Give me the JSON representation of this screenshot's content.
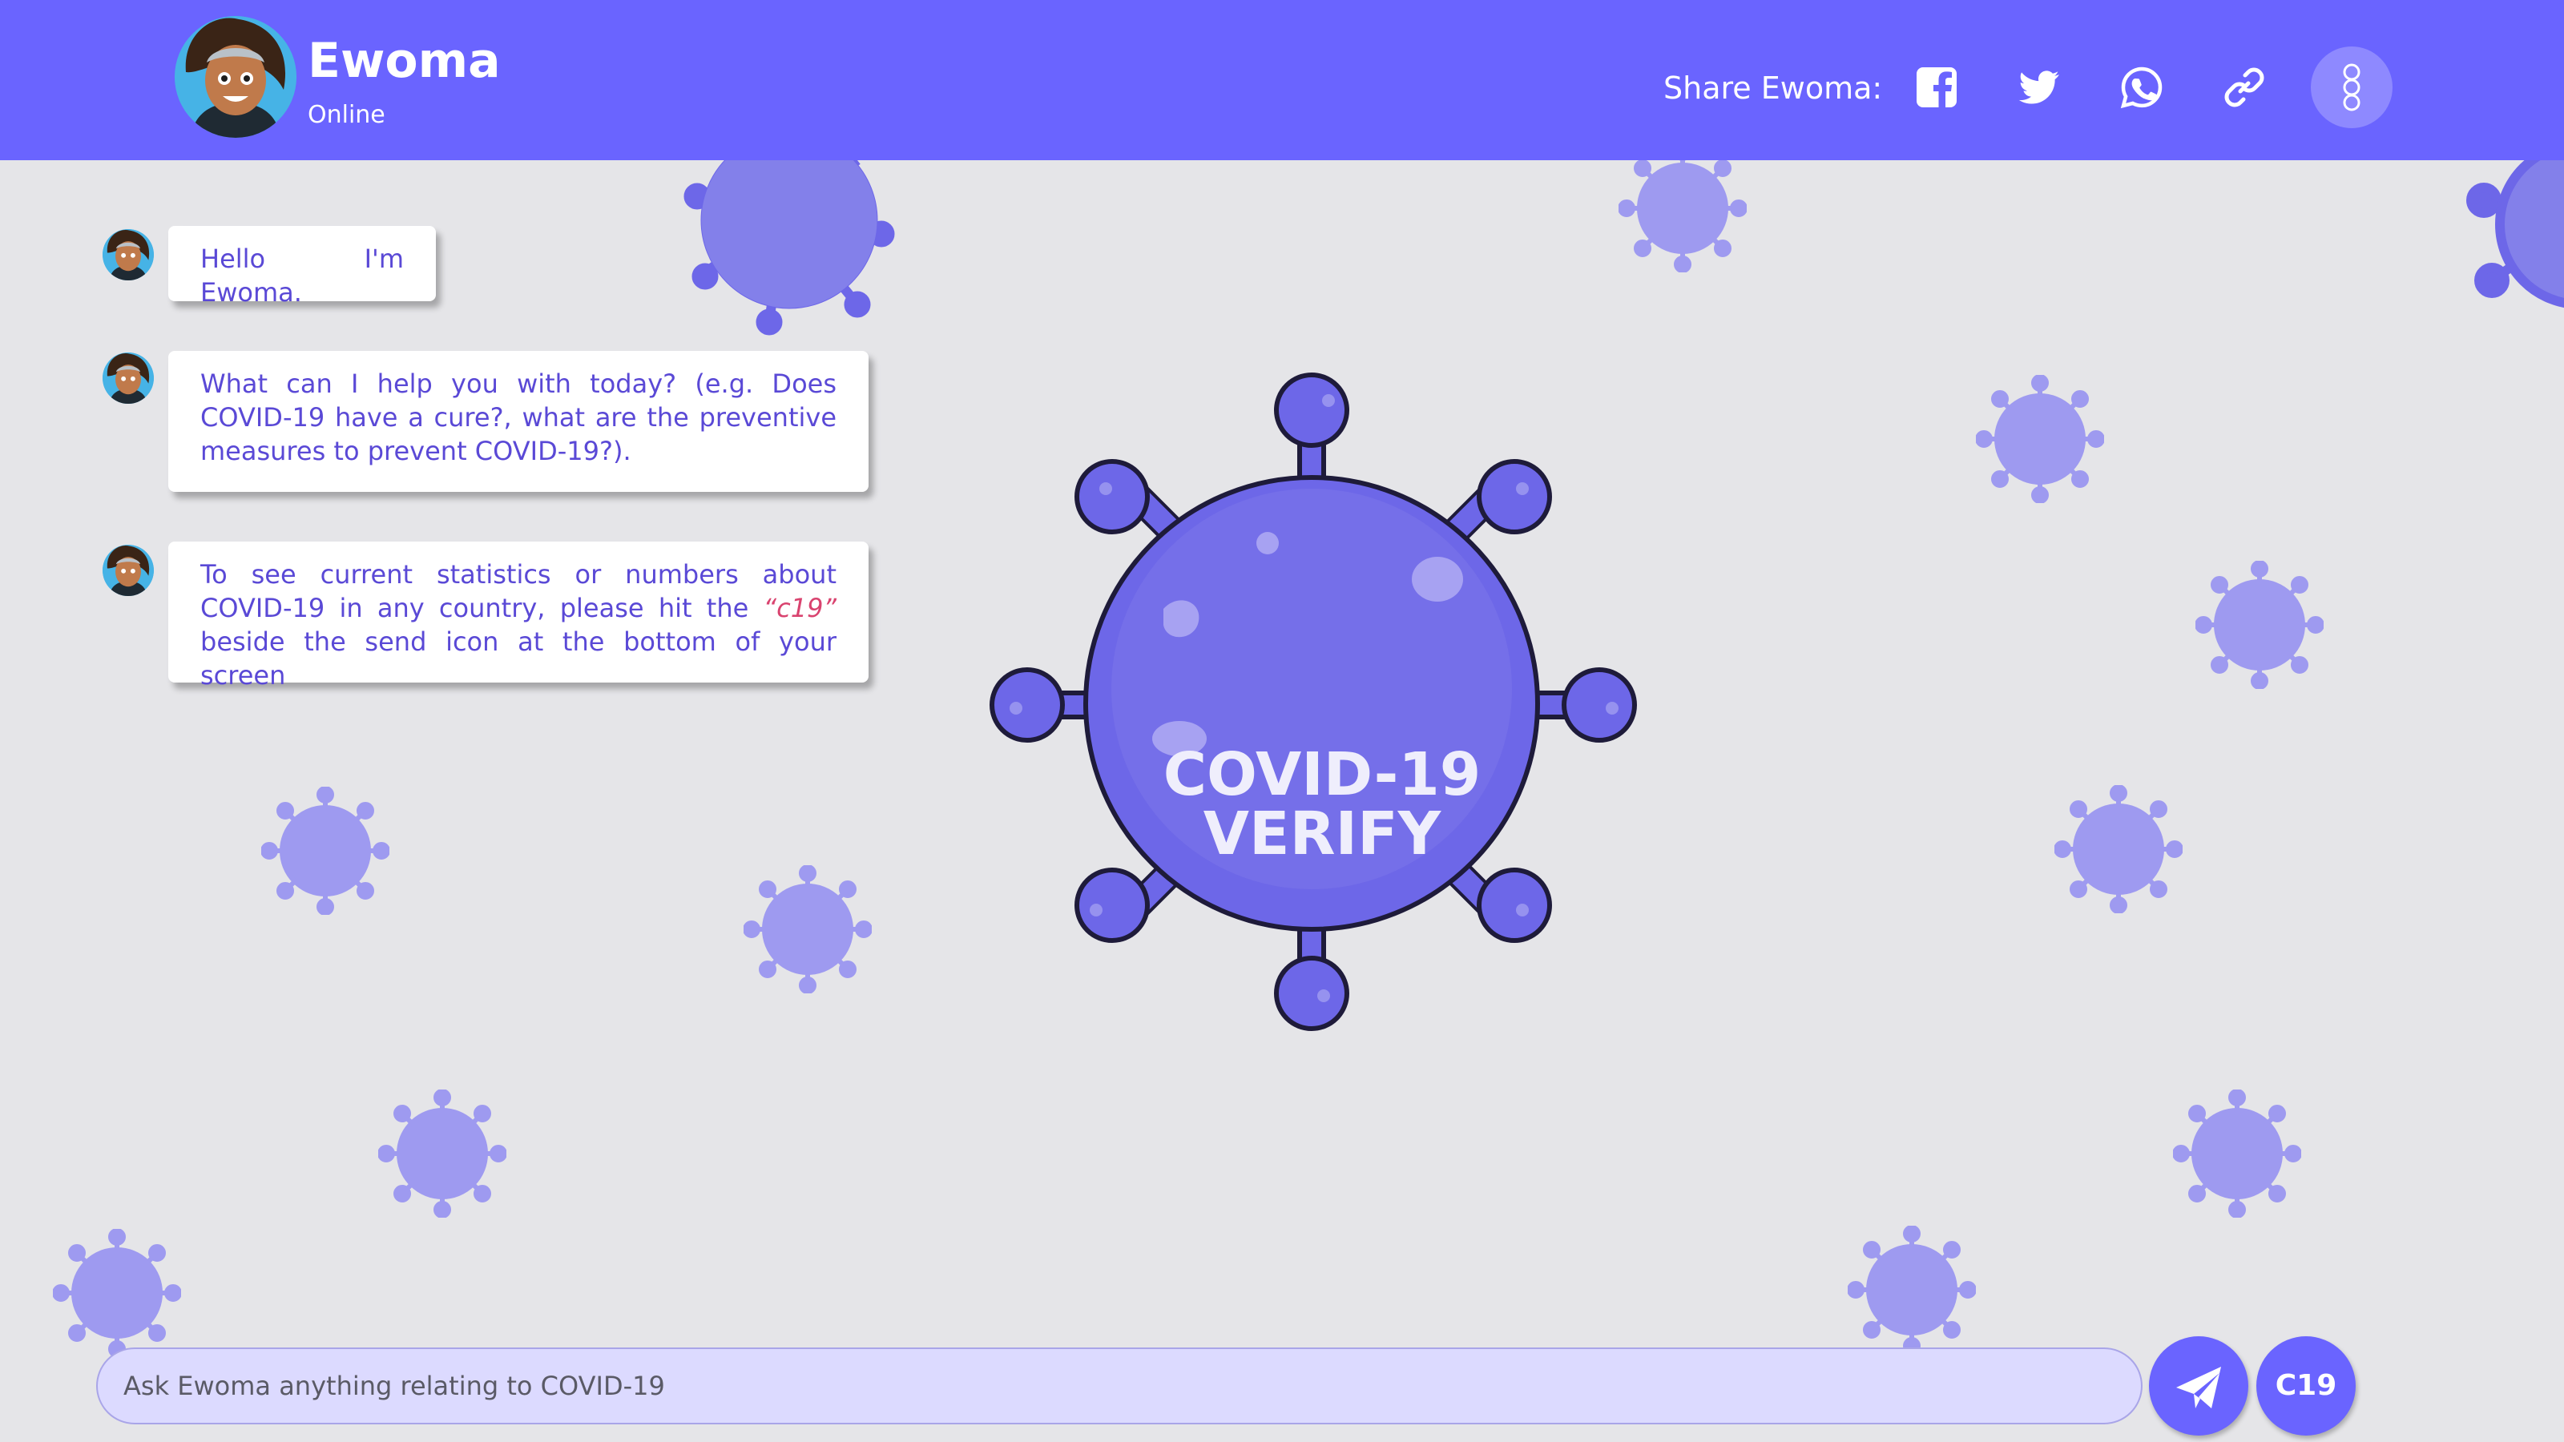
{
  "header": {
    "bot_name": "Ewoma",
    "status": "Online",
    "share_label": "Share Ewoma:",
    "share_icons": [
      "facebook-icon",
      "twitter-icon",
      "whatsapp-icon",
      "link-icon"
    ],
    "menu_icon": "more-vertical-icon"
  },
  "chat": {
    "messages": [
      {
        "sender": "Ewoma",
        "text": "Hello I'm Ewoma."
      },
      {
        "sender": "Ewoma",
        "text": "What can I help you with today? (e.g. Does COVID-19 have a cure?, what are the preventive measures to prevent COVID-19?)."
      },
      {
        "sender": "Ewoma",
        "text_before": "To see current statistics or numbers about COVID-19 in any country, please hit the ",
        "highlight": "“c19”",
        "text_after": " beside the send icon at the bottom of your screen"
      }
    ]
  },
  "logo": {
    "line1": "COVID-19",
    "line2": "VERIFY"
  },
  "input": {
    "placeholder": "Ask Ewoma anything relating to COVID-19",
    "value": ""
  },
  "buttons": {
    "send_icon": "send-icon",
    "c19_label": "C19"
  },
  "colors": {
    "primary": "#6a64ff",
    "background": "#e5e5e8",
    "bubble_text": "#5a49d6",
    "highlight": "#d9436f",
    "virus": "#8e89f0"
  }
}
